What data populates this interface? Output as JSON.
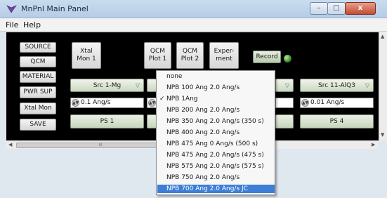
{
  "window": {
    "title": "MnPnl Main Panel",
    "min_glyph": "–",
    "max_glyph": "□",
    "close_glyph": "x"
  },
  "menu": {
    "file": "File",
    "help": "Help"
  },
  "left_buttons": [
    "SOURCE",
    "QCM",
    "MATERIAL",
    "PWR SUP",
    "Xtal Mon",
    "SAVE"
  ],
  "top_buttons": {
    "xtal_mon_1": [
      "Xtal",
      "Mon 1"
    ],
    "qcm_plot_1": [
      "QCM",
      "Plot 1"
    ],
    "qcm_plot_2": [
      "QCM",
      "Plot 2"
    ],
    "experiment": [
      "Exper-",
      "ment"
    ],
    "record": "Record"
  },
  "sources": {
    "src1": {
      "label": "Src 1-Mg",
      "rate": "0.1 Ang/s",
      "ps": "PS 1"
    },
    "src11": {
      "label": "Src 11-AlQ3",
      "rate": "0.01 Ang/s",
      "ps": "PS 4"
    }
  },
  "popup": {
    "items": [
      "none",
      "NPB 100 Ang 2.0 Ang/s",
      "NPB 1Ang",
      "NPB 200 Ang 2.0 Ang/s",
      "NPB 350 Ang 2.0 Ang/s (350 s)",
      "NPB 400 Ang 2.0 Ang/s",
      "NPB 475 Ang 0 Ang/s (500 s)",
      "NPB 475 Ang 2.0 Ang/s (475 s)",
      "NPB 575 Ang 2.0 Ang/s (575 s)",
      "NPB 750 Ang 2.0 Ang/s",
      "NPB 700 Ang 2.0 Ang/s JC"
    ],
    "checked_index": 2,
    "highlighted_index": 10,
    "check_glyph": "✓"
  },
  "scrollbar": {
    "thumb_grip": "III"
  },
  "colors": {
    "panel_bg": "#000000",
    "highlight": "#3d7ed6",
    "record_led": "#2f7a22"
  }
}
